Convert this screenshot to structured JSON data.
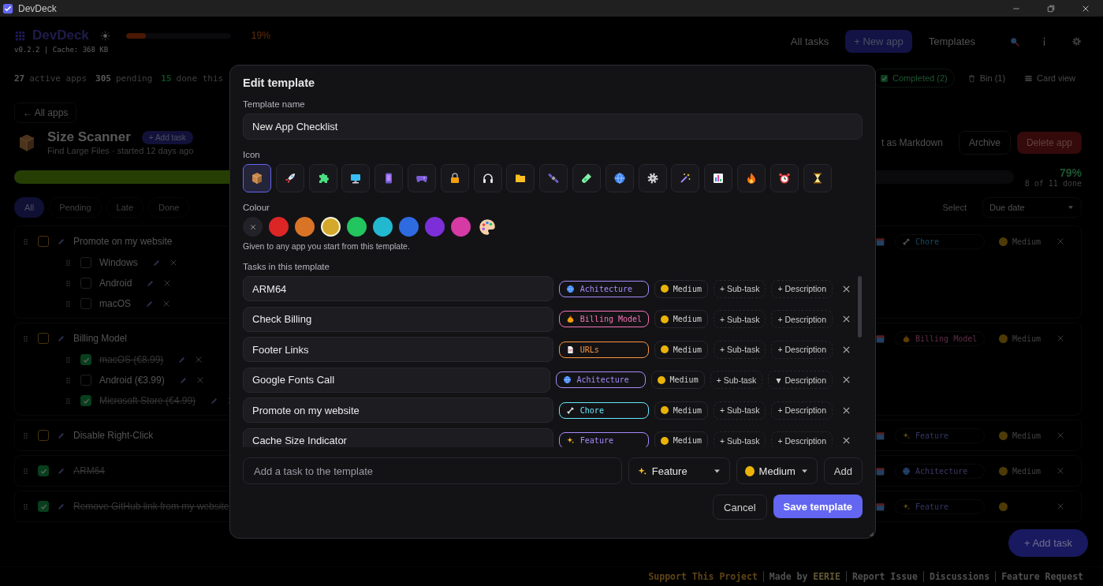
{
  "window": {
    "title": "DevDeck"
  },
  "header": {
    "brand": "DevDeck",
    "progress": {
      "level": 0.19,
      "reading": "19%"
    },
    "version": "v0.2.2 | Cache: 368 KB",
    "nav": [
      {
        "label": "All tasks",
        "kind": "link"
      },
      {
        "label": "+ New app",
        "kind": "primary"
      },
      {
        "label": "Templates",
        "kind": "link"
      }
    ]
  },
  "stats": [
    {
      "count": "27",
      "label": "active apps",
      "kind": "active"
    },
    {
      "count": "305",
      "label": "pending",
      "kind": "pending"
    },
    {
      "count": "15",
      "label": "done this",
      "kind": "done"
    }
  ],
  "view_controls": [
    {
      "label": "Completed (2)",
      "kind": "completed"
    },
    {
      "label": "Bin (1)",
      "kind": "bin"
    },
    {
      "label": "Card view",
      "kind": "cards"
    }
  ],
  "app": {
    "back": "← All apps",
    "name": "Size Scanner",
    "add_task": "+ Add task",
    "subtitle": "Find Large Files · started 12 days ago",
    "actions": [
      {
        "label": "t as Markdown",
        "kind": "plain"
      },
      {
        "label": "Archive",
        "kind": "outline"
      },
      {
        "label": "Delete app",
        "kind": "danger"
      }
    ],
    "progress": {
      "level": 0.79,
      "percent": "79%",
      "count": "8 of 11 done"
    }
  },
  "filters": [
    {
      "label": "All",
      "selected": true
    },
    {
      "label": "Pending",
      "selected": false
    },
    {
      "label": "Late",
      "selected": false
    },
    {
      "label": "Done",
      "selected": false
    }
  ],
  "select": "Select",
  "sort": "Due date",
  "tasks": [
    {
      "title": "Promote on my website",
      "done": false,
      "category": {
        "label": "Chore",
        "kind": "bone"
      },
      "priority": "Medium",
      "children": [
        {
          "title": "Windows",
          "done": false
        },
        {
          "title": "Android",
          "done": false
        },
        {
          "title": "macOS",
          "done": false
        }
      ]
    },
    {
      "title": "Billing Model",
      "done": false,
      "category": {
        "label": "Billing Model",
        "kind": "money-bag"
      },
      "priority": "Medium",
      "children": [
        {
          "title": "macOS (€8.99)",
          "done": true
        },
        {
          "title": "Android (€3.99)",
          "done": false
        },
        {
          "title": "Microsoft Store (€4.99)",
          "done": true
        }
      ]
    },
    {
      "title": "Disable Right-Click",
      "done": false,
      "category": {
        "label": "Feature",
        "kind": "sparkles"
      },
      "priority": "Medium"
    },
    {
      "title": "ARM64",
      "done": true,
      "category": {
        "label": "Achitecture",
        "kind": "globe"
      },
      "priority": "Medium"
    },
    {
      "title": "Remove GitHub link from my website",
      "done": true,
      "category": {
        "label": "Feature",
        "kind": "sparkles"
      }
    }
  ],
  "fab": "+ Add task",
  "footer": [
    {
      "text": "Support This Project",
      "kind": "highlight"
    },
    {
      "text": "Made by **EERIE**",
      "kind": "plain"
    },
    {
      "text": "Report Issue",
      "kind": "plain"
    },
    {
      "text": "Discussions",
      "kind": "plain"
    },
    {
      "text": "Feature Request",
      "kind": "plain"
    }
  ],
  "dialog": {
    "title": "Edit template",
    "name_field": {
      "label": "Template name",
      "value": "New App Checklist"
    },
    "icon_picker": {
      "label": "Icon",
      "options": [
        {
          "kind": "package",
          "selected": true
        },
        {
          "kind": "rocket",
          "selected": false
        },
        {
          "kind": "puzzle",
          "selected": false
        },
        {
          "kind": "monitor",
          "selected": false
        },
        {
          "kind": "phone",
          "selected": false
        },
        {
          "kind": "gamepad",
          "selected": false
        },
        {
          "kind": "lock",
          "selected": false
        },
        {
          "kind": "headphones",
          "selected": false
        },
        {
          "kind": "folder",
          "selected": false
        },
        {
          "kind": "satellite",
          "selected": false
        },
        {
          "kind": "test-tube",
          "selected": false
        },
        {
          "kind": "globe",
          "selected": false
        },
        {
          "kind": "gear",
          "selected": false
        },
        {
          "kind": "wand",
          "selected": false
        },
        {
          "kind": "bar-chart",
          "selected": false
        },
        {
          "kind": "flame",
          "selected": false
        },
        {
          "kind": "alarm-clock",
          "selected": false
        },
        {
          "kind": "hourglass",
          "selected": false
        }
      ]
    },
    "colour_picker": {
      "label": "Colour",
      "hint": "Given to any app you start from this template.",
      "options": [
        {
          "kind": "none",
          "selected": false
        },
        {
          "kind": "swatch",
          "color": "#dc2626",
          "selected": false
        },
        {
          "kind": "swatch",
          "color": "#d97326",
          "selected": false
        },
        {
          "kind": "swatch",
          "color": "#d4a82a",
          "selected": true
        },
        {
          "kind": "swatch",
          "color": "#22c55e",
          "selected": false
        },
        {
          "kind": "swatch",
          "color": "#22b8cf",
          "selected": false
        },
        {
          "kind": "swatch",
          "color": "#2f6be0",
          "selected": false
        },
        {
          "kind": "swatch",
          "color": "#7c2fd8",
          "selected": false
        },
        {
          "kind": "swatch",
          "color": "#d63aa5",
          "selected": false
        },
        {
          "kind": "custom",
          "selected": false
        }
      ]
    },
    "tasks_label": "Tasks in this template",
    "tasks": [
      {
        "name": "ARM64",
        "category": {
          "label": "Achitecture",
          "kind": "globe",
          "color": "#a78bfa"
        },
        "priority": {
          "label": "Medium",
          "color": "#eab308"
        },
        "subtask": "+ Sub-task",
        "description": "+ Description"
      },
      {
        "name": "Check Billing",
        "category": {
          "label": "Billing Model",
          "kind": "money-bag",
          "color": "#f472b6"
        },
        "priority": {
          "label": "Medium",
          "color": "#eab308"
        },
        "subtask": "+ Sub-task",
        "description": "+ Description"
      },
      {
        "name": "Footer Links",
        "category": {
          "label": "URLs",
          "kind": "page",
          "color": "#fb923c"
        },
        "priority": {
          "label": "Medium",
          "color": "#eab308"
        },
        "subtask": "+ Sub-task",
        "description": "+ Description"
      },
      {
        "name": "Google Fonts Call",
        "category": {
          "label": "Achitecture",
          "kind": "globe",
          "color": "#a78bfa"
        },
        "priority": {
          "label": "Medium",
          "color": "#eab308"
        },
        "subtask": "+ Sub-task",
        "description": "▼ Description"
      },
      {
        "name": "Promote on my website",
        "category": {
          "label": "Chore",
          "kind": "bone",
          "color": "#67e8f9"
        },
        "priority": {
          "label": "Medium",
          "color": "#eab308"
        },
        "subtask": "+ Sub-task",
        "description": "+ Description"
      },
      {
        "name": "Cache Size Indicator",
        "category": {
          "label": "Feature",
          "kind": "sparkles",
          "color": "#a78bfa"
        },
        "priority": {
          "label": "Medium",
          "color": "#eab308"
        },
        "subtask": "+ Sub-task",
        "description": "+ Description"
      }
    ],
    "new_task": {
      "placeholder": "Add a task to the template",
      "category": {
        "label": "Feature",
        "kind": "sparkles"
      },
      "priority": {
        "label": "Medium",
        "color": "#eab308"
      },
      "add": "Add"
    },
    "buttons": [
      {
        "label": "Cancel",
        "kind": "secondary"
      },
      {
        "label": "Save template",
        "kind": "primary"
      }
    ]
  }
}
